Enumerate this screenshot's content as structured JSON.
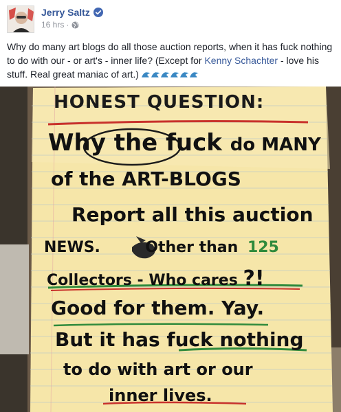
{
  "post": {
    "author": "Jerry Saltz",
    "time": "16 hrs",
    "meta_separator": "·",
    "text_part1": "Why do many art blogs do all those auction reports, when it has fuck nothing to do with our - or art's - inner life? (Except for ",
    "link_text": "Kenny Schachter",
    "text_part2": " - love his stuff. Real great maniac of art.)",
    "wave_emoji_count": 6,
    "accent_color": "#365899",
    "verified_color": "#4267b2"
  },
  "note": {
    "line1": "HONEST QUESTION:",
    "line2a": "Why",
    "line2b": "the fuck",
    "line2c": "do MANY",
    "line3": "of the ART-BLOGS",
    "line4": "Report all this auction",
    "line5a": "NEWS.",
    "line5b": "Other than",
    "line5c": "125",
    "line6a": "Collectors - Who",
    "line6b": "cares",
    "line6c": "?!",
    "line7": "Good for them. Yay.",
    "line8a": "But it has",
    "line8b": "fuck nothing",
    "line9": "to do with art or our",
    "line10": "inner lives."
  }
}
